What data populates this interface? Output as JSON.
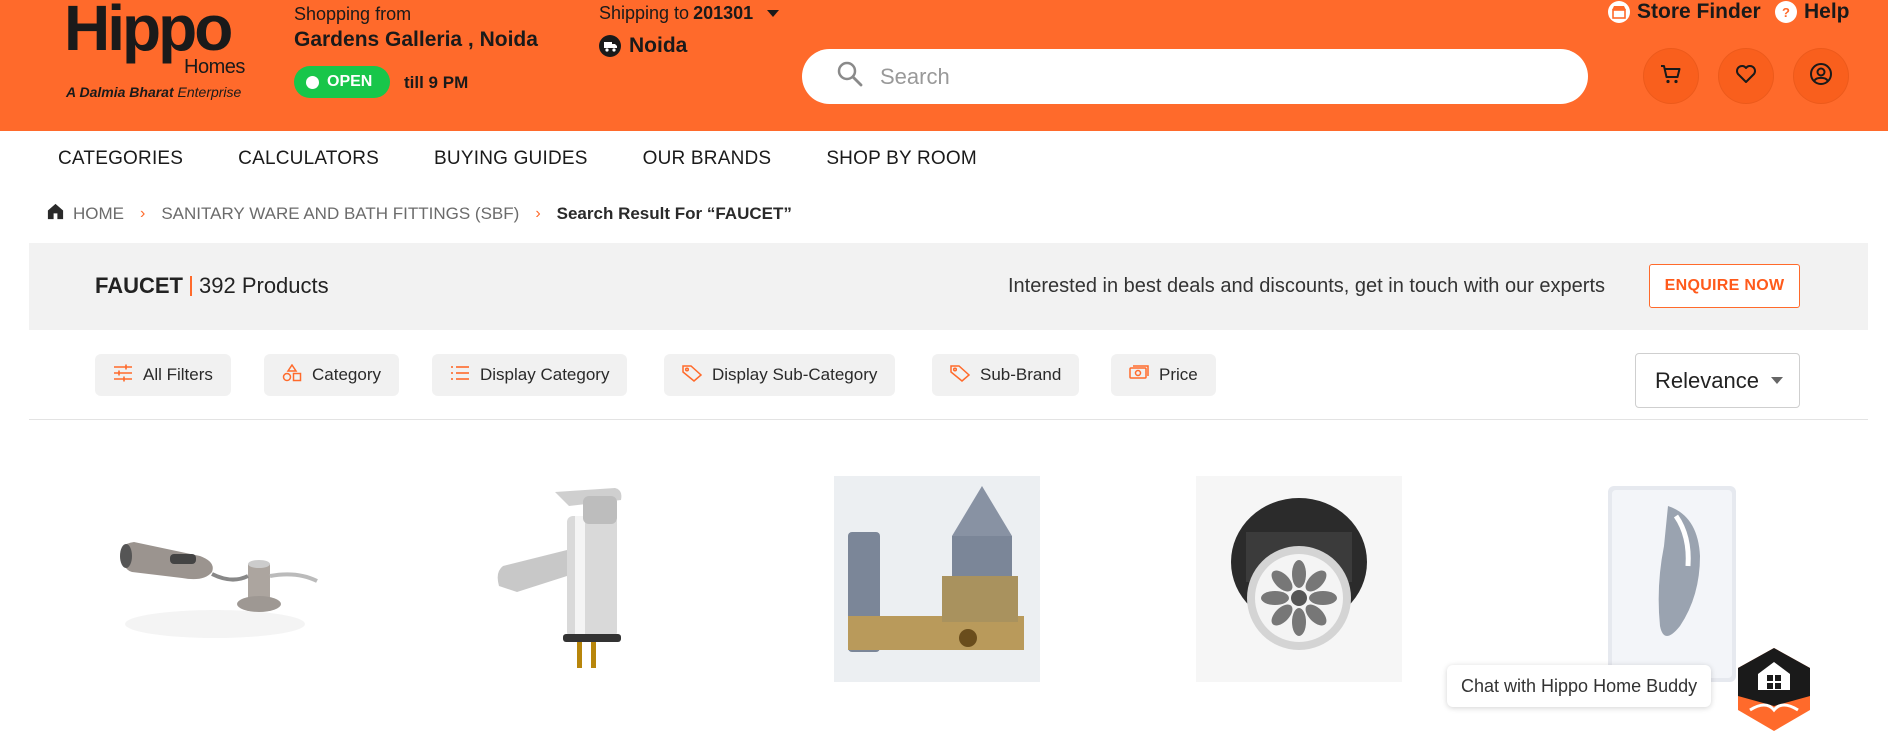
{
  "header": {
    "logo": {
      "main": "Hippo",
      "sub": "Homes",
      "tagline_brand": "A Dalmia Bharat",
      "tagline_rest": "Enterprise"
    },
    "shopping_from_label": "Shopping from",
    "store_name": "Gardens Galleria , Noida",
    "open_status": "OPEN",
    "till_text": "till 9 PM",
    "shipping_label": "Shipping to",
    "shipping_pincode": "201301",
    "shipping_city": "Noida",
    "search": {
      "placeholder": "Search",
      "value": ""
    },
    "store_finder": "Store Finder",
    "help": "Help",
    "icons": [
      "cart-icon",
      "heart-icon",
      "user-icon"
    ]
  },
  "nav": {
    "items": [
      {
        "label": "CATEGORIES"
      },
      {
        "label": "CALCULATORS"
      },
      {
        "label": "BUYING GUIDES"
      },
      {
        "label": "OUR BRANDS"
      },
      {
        "label": "SHOP BY ROOM"
      }
    ]
  },
  "breadcrumb": {
    "home": "HOME",
    "category": "SANITARY WARE AND BATH FITTINGS (SBF)",
    "current": "Search Result For “FAUCET”"
  },
  "results": {
    "term": "FAUCET",
    "count_text": "392 Products",
    "enquire_text": "Interested in best deals and discounts, get in touch with our experts",
    "enquire_button": "ENQUIRE NOW"
  },
  "filters": [
    {
      "label": "All Filters",
      "icon": "sliders-icon"
    },
    {
      "label": "Category",
      "icon": "shapes-icon"
    },
    {
      "label": "Display Category",
      "icon": "list-icon"
    },
    {
      "label": "Display Sub-Category",
      "icon": "tag-icon"
    },
    {
      "label": "Sub-Brand",
      "icon": "tag-icon"
    },
    {
      "label": "Price",
      "icon": "money-icon"
    }
  ],
  "sort": {
    "selected": "Relevance"
  },
  "products": [
    {
      "name": "pull-out-spray-faucet"
    },
    {
      "name": "single-lever-basin-mixer"
    },
    {
      "name": "concealed-valve-body"
    },
    {
      "name": "bottle-trap-waste"
    },
    {
      "name": "concealed-diverter"
    }
  ],
  "chat": {
    "label": "Chat with Hippo Home Buddy"
  },
  "colors": {
    "brand": "#ff6a2b",
    "open_green": "#18c64a",
    "bar_bg": "#f2f2f2"
  }
}
